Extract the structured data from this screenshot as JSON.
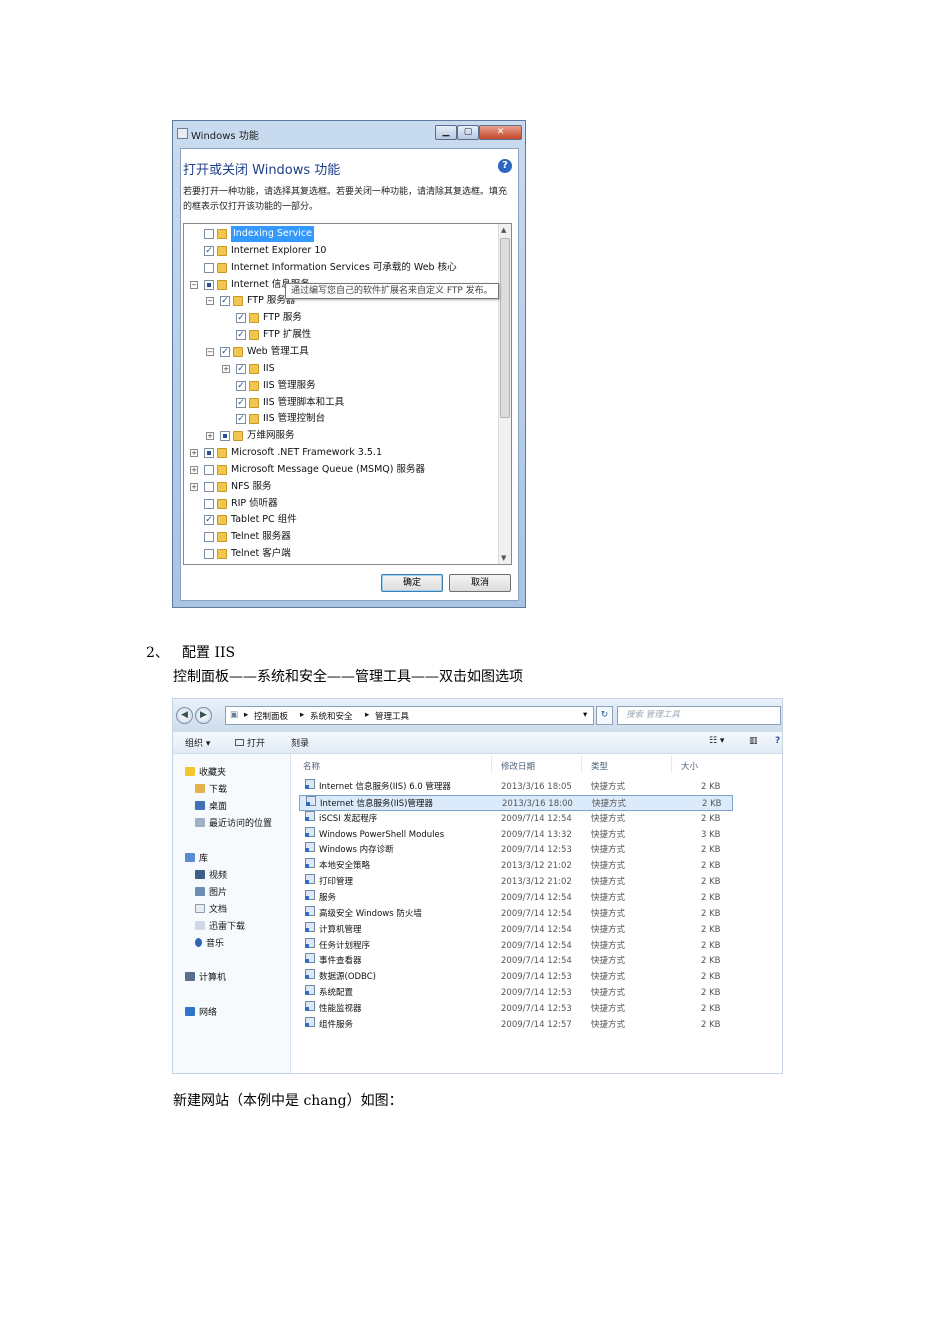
{
  "dialog": {
    "title": "Windows 功能",
    "minimize_glyph": "▁",
    "maximize_glyph": "▢",
    "close_glyph": "✕",
    "heading": "打开或关闭 Windows 功能",
    "help_glyph": "?",
    "description": "若要打开一种功能，请选择其复选框。若要关闭一种功能，请清除其复选框。填充的框表示仅打开该功能的一部分。",
    "tooltip": "通过编写您自己的软件扩展名来自定义 FTP 发布。",
    "ok_label": "确定",
    "cancel_label": "取消",
    "features": [
      {
        "label": "Indexing Service",
        "state": "unchecked",
        "expander": "",
        "selected": true
      },
      {
        "label": "Internet Explorer 10",
        "state": "checked",
        "expander": ""
      },
      {
        "label": "Internet Information Services 可承载的 Web 核心",
        "state": "unchecked",
        "expander": ""
      },
      {
        "label": "Internet 信息服务",
        "state": "partial",
        "expander": "-"
      },
      {
        "label": "FTP 服务器",
        "state": "checked",
        "expander": "-"
      },
      {
        "label": "FTP 服务",
        "state": "checked",
        "expander": ""
      },
      {
        "label": "FTP 扩展性",
        "state": "checked",
        "expander": ""
      },
      {
        "label": "Web 管理工具",
        "state": "checked",
        "expander": "-"
      },
      {
        "label": "IIS",
        "state": "checked",
        "expander": "+"
      },
      {
        "label": "IIS 管理服务",
        "state": "checked",
        "expander": ""
      },
      {
        "label": "IIS 管理脚本和工具",
        "state": "checked",
        "expander": ""
      },
      {
        "label": "IIS 管理控制台",
        "state": "checked",
        "expander": ""
      },
      {
        "label": "万维网服务",
        "state": "partial",
        "expander": "+"
      },
      {
        "label": "Microsoft .NET Framework 3.5.1",
        "state": "partial",
        "expander": "+"
      },
      {
        "label": "Microsoft Message Queue (MSMQ) 服务器",
        "state": "unchecked",
        "expander": "+"
      },
      {
        "label": "NFS 服务",
        "state": "unchecked",
        "expander": "+"
      },
      {
        "label": "RIP 侦听器",
        "state": "unchecked",
        "expander": ""
      },
      {
        "label": "Tablet PC 组件",
        "state": "checked",
        "expander": ""
      },
      {
        "label": "Telnet 服务器",
        "state": "unchecked",
        "expander": ""
      },
      {
        "label": "Telnet 客户端",
        "state": "unchecked",
        "expander": ""
      }
    ]
  },
  "doc": {
    "step_number": "2、",
    "step_title": "配置 IIS",
    "instruction": "控制面板——系统和安全——管理工具——双击如图选项",
    "new_site": "新建网站（本例中是 chang）如图："
  },
  "explorer": {
    "back_glyph": "◀",
    "forward_glyph": "▶",
    "breadcrumb": [
      "控制面板",
      "系统和安全",
      "管理工具"
    ],
    "breadcrumb_sep": "▸",
    "dropdown_glyph": "▾",
    "refresh_glyph": "↻",
    "search_placeholder": "搜索 管理工具",
    "commands": {
      "organize": "组织 ▾",
      "open": "打开",
      "burn": "刻录",
      "view": "☷ ▾",
      "pane": "▥",
      "help": "?"
    },
    "sidebar": {
      "favorites": "收藏夹",
      "fav_items": [
        "下载",
        "桌面",
        "最近访问的位置"
      ],
      "libraries": "库",
      "lib_items": [
        "视频",
        "图片",
        "文档",
        "迅雷下载",
        "音乐"
      ],
      "computer": "计算机",
      "network": "网络"
    },
    "columns": {
      "name": "名称",
      "date": "修改日期",
      "type": "类型",
      "size": "大小"
    },
    "files": [
      {
        "name": "Internet 信息服务(IIS) 6.0 管理器",
        "date": "2013/3/16 18:05",
        "type": "快捷方式",
        "size": "2 KB"
      },
      {
        "name": "Internet 信息服务(IIS)管理器",
        "date": "2013/3/16 18:00",
        "type": "快捷方式",
        "size": "2 KB",
        "selected": true
      },
      {
        "name": "iSCSI 发起程序",
        "date": "2009/7/14 12:54",
        "type": "快捷方式",
        "size": "2 KB"
      },
      {
        "name": "Windows PowerShell Modules",
        "date": "2009/7/14 13:32",
        "type": "快捷方式",
        "size": "3 KB"
      },
      {
        "name": "Windows 内存诊断",
        "date": "2009/7/14 12:53",
        "type": "快捷方式",
        "size": "2 KB"
      },
      {
        "name": "本地安全策略",
        "date": "2013/3/12 21:02",
        "type": "快捷方式",
        "size": "2 KB"
      },
      {
        "name": "打印管理",
        "date": "2013/3/12 21:02",
        "type": "快捷方式",
        "size": "2 KB"
      },
      {
        "name": "服务",
        "date": "2009/7/14 12:54",
        "type": "快捷方式",
        "size": "2 KB"
      },
      {
        "name": "高级安全 Windows 防火墙",
        "date": "2009/7/14 12:54",
        "type": "快捷方式",
        "size": "2 KB"
      },
      {
        "name": "计算机管理",
        "date": "2009/7/14 12:54",
        "type": "快捷方式",
        "size": "2 KB"
      },
      {
        "name": "任务计划程序",
        "date": "2009/7/14 12:54",
        "type": "快捷方式",
        "size": "2 KB"
      },
      {
        "name": "事件查看器",
        "date": "2009/7/14 12:54",
        "type": "快捷方式",
        "size": "2 KB"
      },
      {
        "name": "数据源(ODBC)",
        "date": "2009/7/14 12:53",
        "type": "快捷方式",
        "size": "2 KB"
      },
      {
        "name": "系统配置",
        "date": "2009/7/14 12:53",
        "type": "快捷方式",
        "size": "2 KB"
      },
      {
        "name": "性能监视器",
        "date": "2009/7/14 12:53",
        "type": "快捷方式",
        "size": "2 KB"
      },
      {
        "name": "组件服务",
        "date": "2009/7/14 12:57",
        "type": "快捷方式",
        "size": "2 KB"
      }
    ]
  }
}
